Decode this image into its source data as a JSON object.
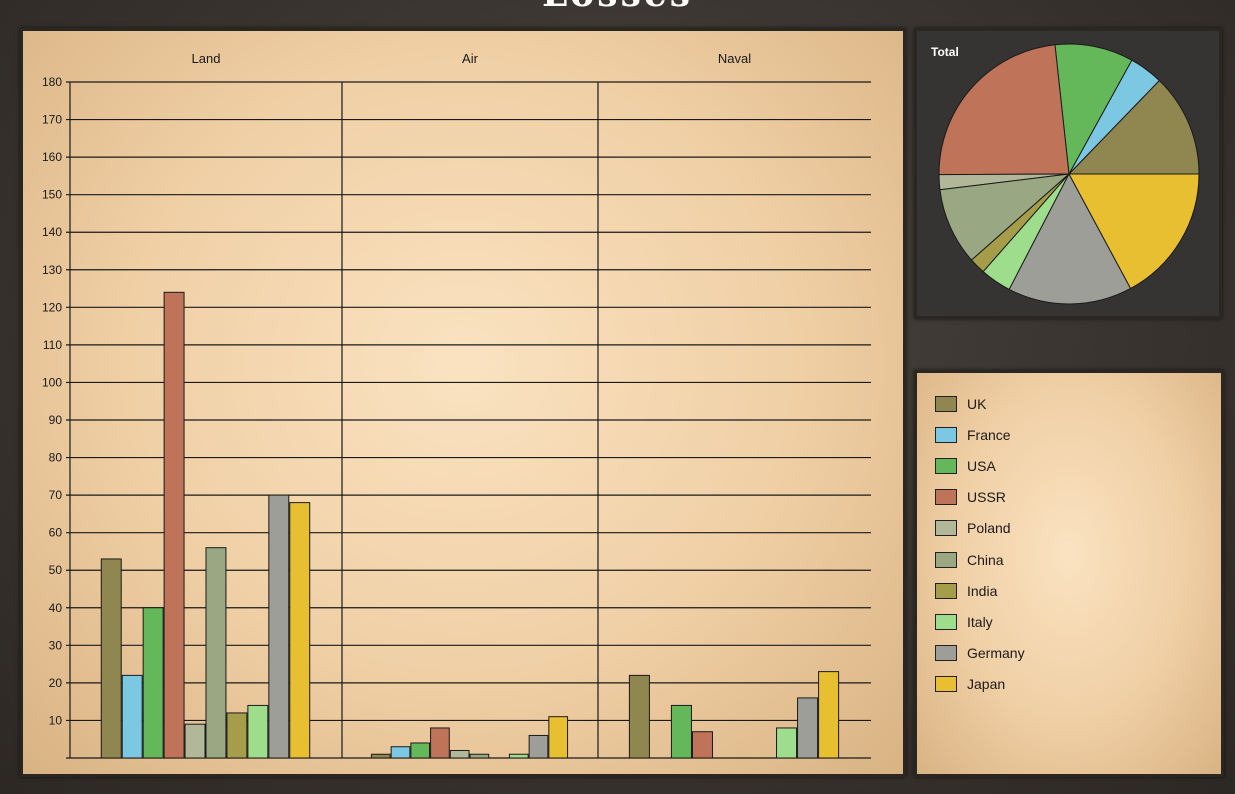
{
  "title": "Losses",
  "chart_data": [
    {
      "type": "bar",
      "groups": [
        "Land",
        "Air",
        "Naval"
      ],
      "ylim": [
        0,
        180
      ],
      "yticks": [
        10,
        20,
        30,
        40,
        50,
        60,
        70,
        80,
        90,
        100,
        110,
        120,
        130,
        140,
        150,
        160,
        170,
        180
      ],
      "grid": true,
      "series": [
        {
          "name": "UK",
          "color": "#8f8650",
          "values": [
            53,
            1,
            22
          ]
        },
        {
          "name": "France",
          "color": "#7cc8e3",
          "values": [
            22,
            3,
            0
          ]
        },
        {
          "name": "USA",
          "color": "#64b85a",
          "values": [
            40,
            4,
            14
          ]
        },
        {
          "name": "USSR",
          "color": "#bf7358",
          "values": [
            124,
            8,
            7
          ]
        },
        {
          "name": "Poland",
          "color": "#b3b799",
          "values": [
            9,
            2,
            0
          ]
        },
        {
          "name": "China",
          "color": "#99a882",
          "values": [
            56,
            1,
            0
          ]
        },
        {
          "name": "India",
          "color": "#a69d4b",
          "values": [
            12,
            0,
            0
          ]
        },
        {
          "name": "Italy",
          "color": "#9ddd8c",
          "values": [
            14,
            1,
            8
          ]
        },
        {
          "name": "Germany",
          "color": "#9e9e98",
          "values": [
            70,
            6,
            16
          ]
        },
        {
          "name": "Japan",
          "color": "#e8bf30",
          "values": [
            68,
            11,
            23
          ]
        }
      ]
    },
    {
      "type": "pie",
      "title": "Total",
      "slices": [
        {
          "name": "UK",
          "value": 76
        },
        {
          "name": "France",
          "value": 25
        },
        {
          "name": "USA",
          "value": 58
        },
        {
          "name": "USSR",
          "value": 139
        },
        {
          "name": "Poland",
          "value": 11
        },
        {
          "name": "China",
          "value": 57
        },
        {
          "name": "India",
          "value": 12
        },
        {
          "name": "Italy",
          "value": 23
        },
        {
          "name": "Germany",
          "value": 92
        },
        {
          "name": "Japan",
          "value": 102
        }
      ]
    }
  ]
}
